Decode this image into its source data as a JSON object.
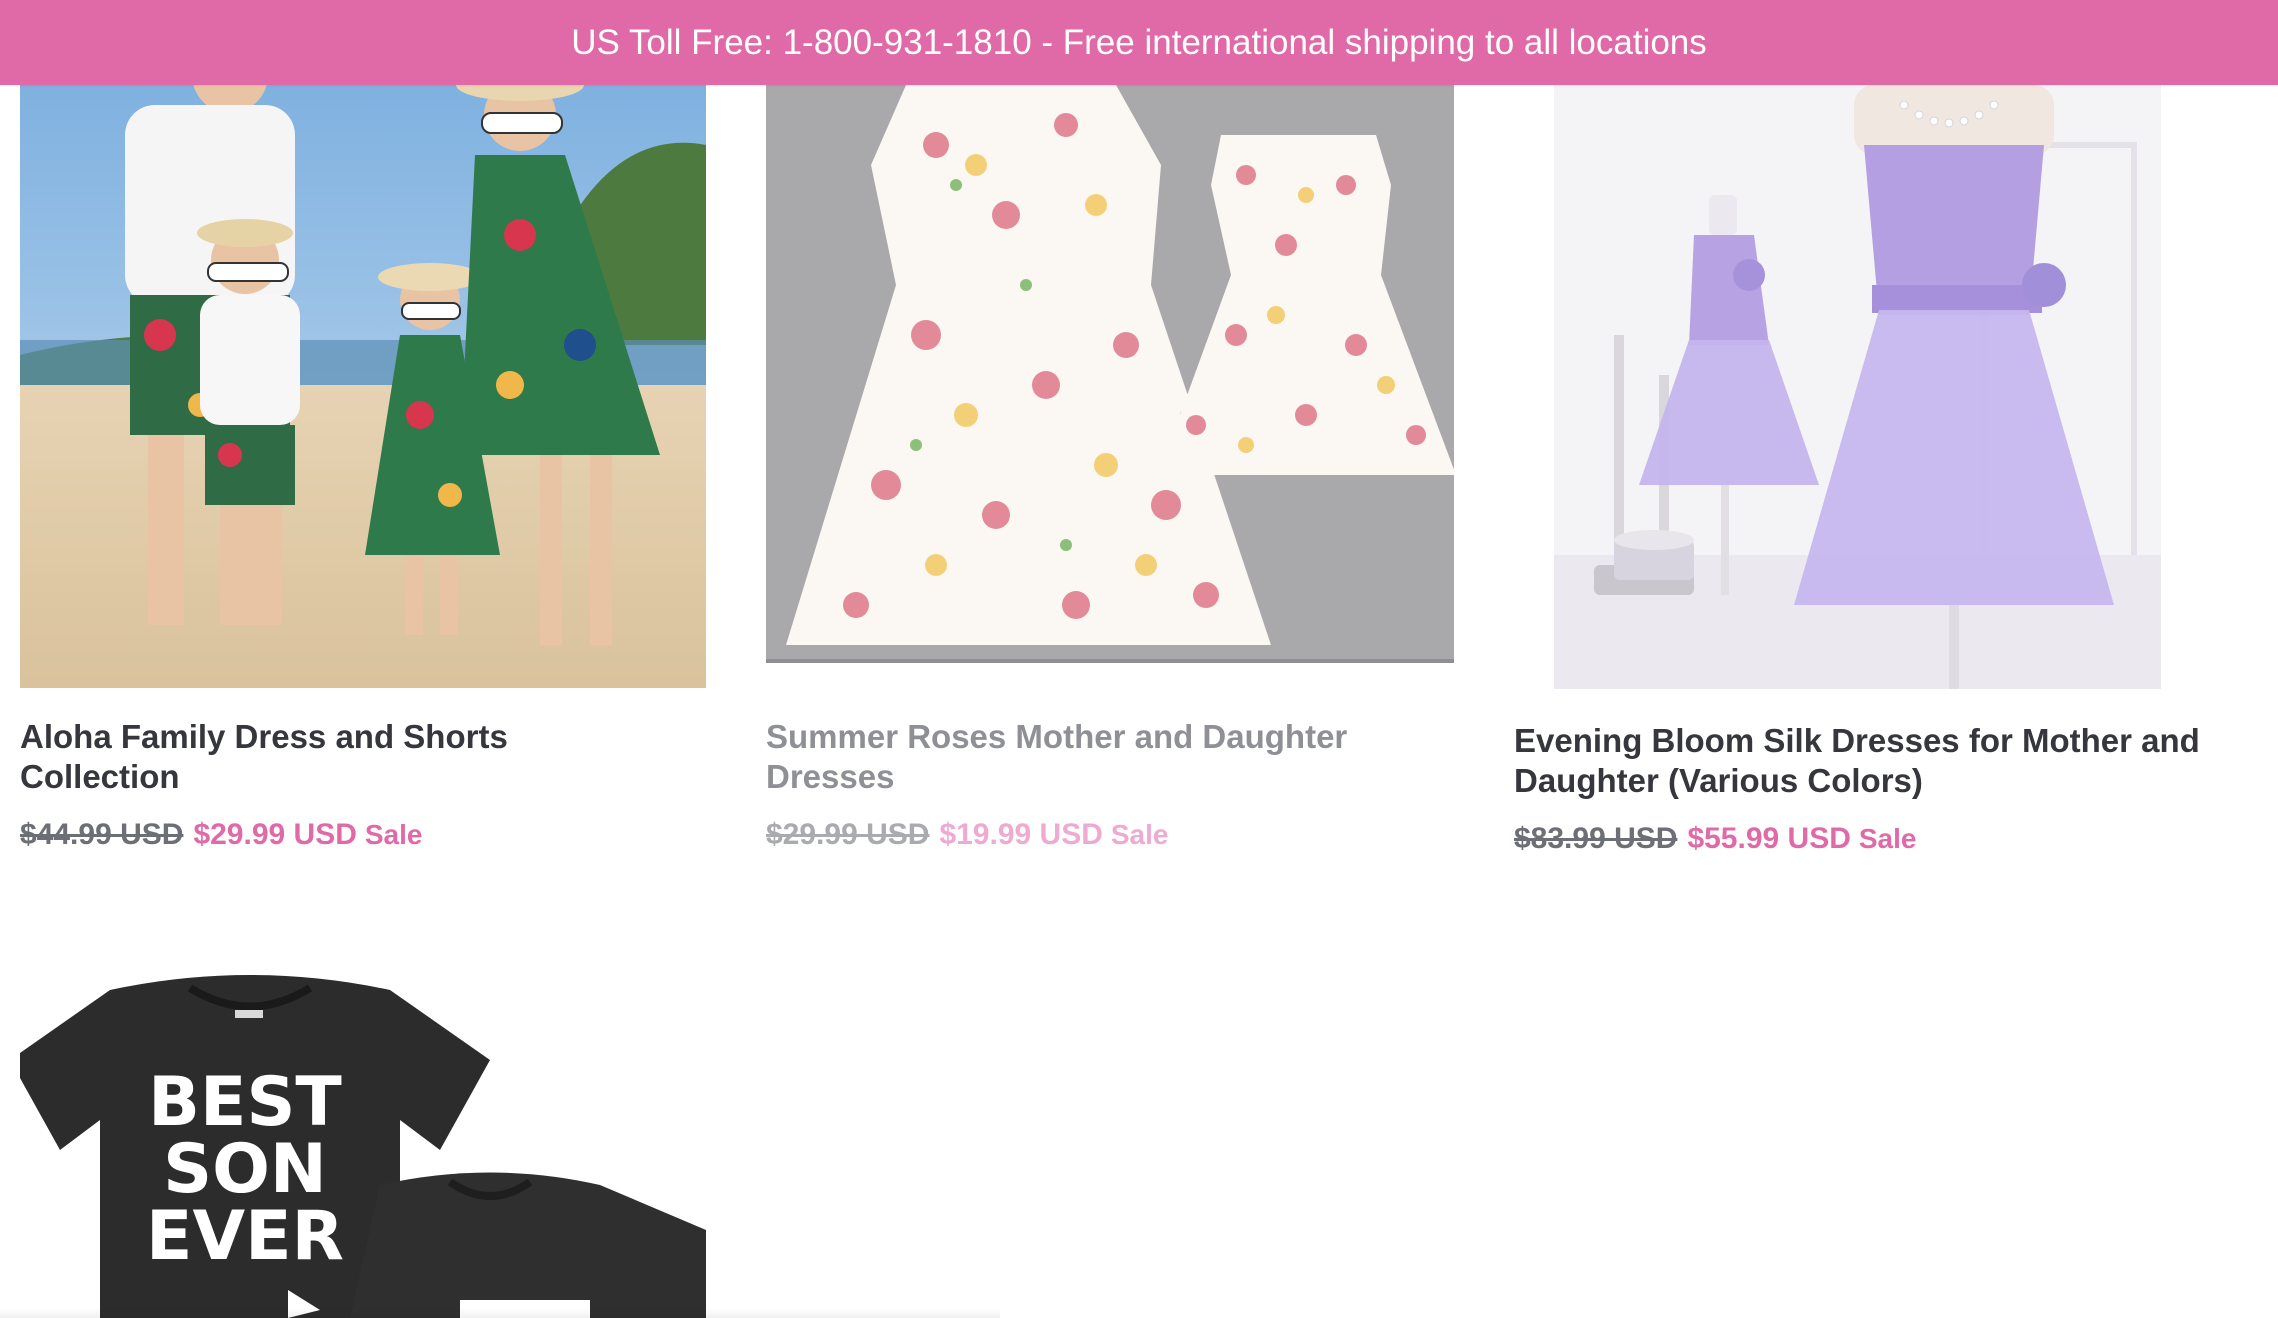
{
  "announcement": {
    "text": "US Toll Free: 1-800-931-1810 - Free international shipping to all locations"
  },
  "products": [
    {
      "title": "Aloha Family Dress and Shorts Collection",
      "compare_price": "$44.99 USD",
      "price": "$29.99 USD",
      "badge": "Sale"
    },
    {
      "title": "Summer Roses Mother and Daughter Dresses",
      "compare_price": "$29.99 USD",
      "price": "$19.99 USD",
      "badge": "Sale"
    },
    {
      "title": "Evening Bloom Silk Dresses for Mother and Daughter (Various Colors)",
      "compare_price": "$83.99 USD",
      "price": "$55.99 USD",
      "badge": "Sale"
    },
    {
      "shirt_text": [
        "BEST",
        "SON",
        "EVER"
      ]
    }
  ],
  "colors": {
    "accent": "#e06aa8",
    "title": "#35373d",
    "muted": "#6c6f75"
  }
}
